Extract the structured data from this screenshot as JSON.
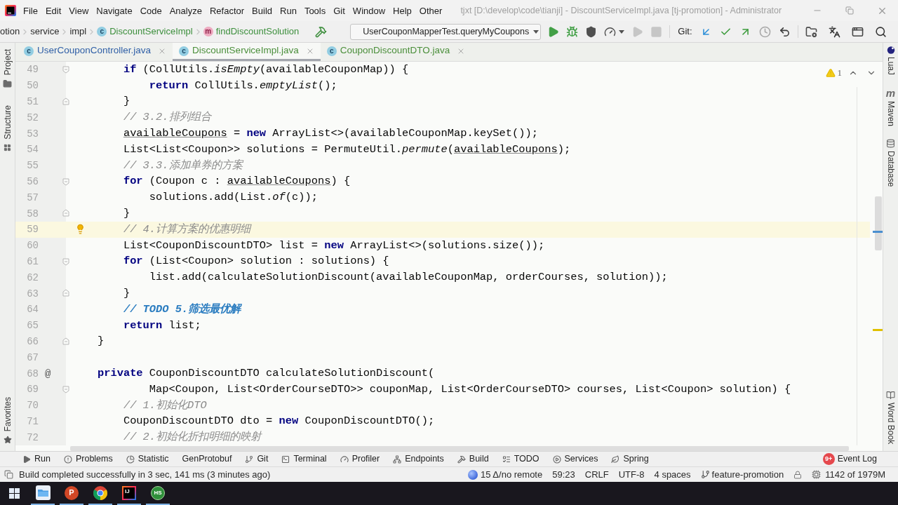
{
  "window": {
    "title": "tjxt [D:\\develop\\code\\tianji] - DiscountServiceImpl.java [tj-promotion] - Administrator"
  },
  "menu": [
    "File",
    "Edit",
    "View",
    "Navigate",
    "Code",
    "Analyze",
    "Refactor",
    "Build",
    "Run",
    "Tools",
    "Git",
    "Window",
    "Help",
    "Other"
  ],
  "breadcrumbs": [
    {
      "kind": "folder",
      "label": "otion"
    },
    {
      "kind": "folder",
      "label": "service"
    },
    {
      "kind": "folder",
      "label": "impl"
    },
    {
      "kind": "class",
      "icon": "c",
      "label": "DiscountServiceImpl"
    },
    {
      "kind": "method",
      "icon": "m",
      "label": "findDiscountSolution"
    }
  ],
  "toolbar": {
    "build": [
      {
        "kind": "build",
        "disabled": false
      }
    ],
    "run_config": {
      "label": "UserCouponMapperTest.queryMyCoupons"
    },
    "run_actions": [
      {
        "kind": "run",
        "disabled": false
      },
      {
        "kind": "debug",
        "disabled": false
      },
      {
        "kind": "coverage",
        "disabled": false
      },
      {
        "kind": "profile",
        "disabled": false
      },
      {
        "kind": "rerun",
        "disabled": true
      },
      {
        "kind": "stop",
        "disabled": true
      }
    ],
    "git": {
      "label": "Git:",
      "actions": [
        {
          "kind": "update",
          "disabled": false
        },
        {
          "kind": "commit",
          "disabled": false
        },
        {
          "kind": "push",
          "disabled": false
        },
        {
          "kind": "history",
          "disabled": false
        },
        {
          "kind": "rollback",
          "disabled": false
        }
      ]
    },
    "tools": [
      {
        "kind": "structure",
        "disabled": false
      },
      {
        "kind": "translate",
        "disabled": false
      },
      {
        "kind": "terminal",
        "disabled": false
      },
      {
        "kind": "search",
        "disabled": false
      }
    ]
  },
  "tabs": [
    {
      "icon": "c",
      "label": "UserCouponController.java",
      "color": "#2f5fa6",
      "selected": false
    },
    {
      "icon": "c",
      "label": "DiscountServiceImpl.java",
      "color": "#4b8f3b",
      "selected": true
    },
    {
      "icon": "c",
      "label": "CouponDiscountDTO.java",
      "color": "#4b8f3b",
      "selected": false
    }
  ],
  "left_tools": {
    "top": [
      {
        "kind": "project",
        "label": "Project"
      },
      {
        "kind": "structure",
        "label": "Structure"
      }
    ],
    "bottom": [
      {
        "kind": "favorites",
        "label": "Favorites"
      }
    ]
  },
  "right_tools": {
    "top": [
      {
        "kind": "luaj",
        "label": "LuaJ"
      },
      {
        "kind": "maven",
        "icon": "m",
        "label": "Maven"
      },
      {
        "kind": "database",
        "label": "Database"
      }
    ],
    "bottom": [
      {
        "kind": "wordbook",
        "label": "Word Book"
      }
    ]
  },
  "editor": {
    "problems": {
      "count": "1"
    },
    "lines": [
      {
        "number": "49",
        "current": false,
        "fold_marker": {
          "kind": "start"
        },
        "tokens": [
          {
            "kind": "keyword",
            "text": "        if"
          },
          {
            "kind": "plain",
            "text": " (CollUtils."
          },
          {
            "kind": "static",
            "text": "isEmpty"
          },
          {
            "kind": "plain",
            "text": "(availableCouponMap)) {"
          }
        ]
      },
      {
        "number": "50",
        "current": false,
        "tokens": [
          {
            "kind": "keyword",
            "text": "            return"
          },
          {
            "kind": "plain",
            "text": " CollUtils."
          },
          {
            "kind": "static",
            "text": "emptyList"
          },
          {
            "kind": "plain",
            "text": "();"
          }
        ]
      },
      {
        "number": "51",
        "current": false,
        "fold_marker": {
          "kind": "end"
        },
        "tokens": [
          {
            "kind": "plain",
            "text": "        }"
          }
        ]
      },
      {
        "number": "52",
        "current": false,
        "tokens": [
          {
            "kind": "comment",
            "text": "        // 3.2.排列组合"
          }
        ]
      },
      {
        "number": "53",
        "current": false,
        "tokens": [
          {
            "kind": "underline",
            "text": "        availableCoupons"
          },
          {
            "kind": "plain",
            "text": " = "
          },
          {
            "kind": "keyword",
            "text": "new"
          },
          {
            "kind": "plain",
            "text": " ArrayList<>(availableCouponMap.keySet());"
          }
        ]
      },
      {
        "number": "54",
        "current": false,
        "tokens": [
          {
            "kind": "plain",
            "text": "        List<List<Coupon>> solutions = PermuteUtil."
          },
          {
            "kind": "static",
            "text": "permute"
          },
          {
            "kind": "plain",
            "text": "("
          },
          {
            "kind": "underline",
            "text": "availableCoupons"
          },
          {
            "kind": "plain",
            "text": ");"
          }
        ]
      },
      {
        "number": "55",
        "current": false,
        "tokens": [
          {
            "kind": "comment",
            "text": "        // 3.3.添加单券的方案"
          }
        ]
      },
      {
        "number": "56",
        "current": false,
        "fold_marker": {
          "kind": "start"
        },
        "tokens": [
          {
            "kind": "keyword",
            "text": "        for"
          },
          {
            "kind": "plain",
            "text": " (Coupon c : "
          },
          {
            "kind": "underline",
            "text": "availableCoupons"
          },
          {
            "kind": "plain",
            "text": ") {"
          }
        ]
      },
      {
        "number": "57",
        "current": false,
        "tokens": [
          {
            "kind": "plain",
            "text": "            solutions.add(List."
          },
          {
            "kind": "static",
            "text": "of"
          },
          {
            "kind": "plain",
            "text": "(c));"
          }
        ]
      },
      {
        "number": "58",
        "current": false,
        "fold_marker": {
          "kind": "end"
        },
        "tokens": [
          {
            "kind": "plain",
            "text": "        }"
          }
        ]
      },
      {
        "number": "59",
        "current": true,
        "gutter_icon": {
          "kind": "bulb"
        },
        "tokens": [
          {
            "kind": "comment",
            "text": "        // 4.计算方案的优惠明细"
          }
        ]
      },
      {
        "number": "60",
        "current": false,
        "tokens": [
          {
            "kind": "plain",
            "text": "        List<CouponDiscountDTO> list = "
          },
          {
            "kind": "keyword",
            "text": "new"
          },
          {
            "kind": "plain",
            "text": " ArrayList<>(solutions.size());"
          }
        ]
      },
      {
        "number": "61",
        "current": false,
        "fold_marker": {
          "kind": "start"
        },
        "tokens": [
          {
            "kind": "keyword",
            "text": "        for"
          },
          {
            "kind": "plain",
            "text": " (List<Coupon> solution : solutions) {"
          }
        ]
      },
      {
        "number": "62",
        "current": false,
        "tokens": [
          {
            "kind": "plain",
            "text": "            list.add(calculateSolutionDiscount(availableCouponMap, orderCourses, solution));"
          }
        ]
      },
      {
        "number": "63",
        "current": false,
        "fold_marker": {
          "kind": "end"
        },
        "tokens": [
          {
            "kind": "plain",
            "text": "        }"
          }
        ]
      },
      {
        "number": "64",
        "current": false,
        "tokens": [
          {
            "kind": "todo",
            "text": "        // TODO 5.筛选最优解"
          }
        ]
      },
      {
        "number": "65",
        "current": false,
        "tokens": [
          {
            "kind": "keyword",
            "text": "        return"
          },
          {
            "kind": "plain",
            "text": " list;"
          }
        ]
      },
      {
        "number": "66",
        "current": false,
        "fold_marker": {
          "kind": "end"
        },
        "tokens": [
          {
            "kind": "plain",
            "text": "    }"
          }
        ]
      },
      {
        "number": "67",
        "current": false
      },
      {
        "number": "68",
        "current": false,
        "gutter_text": "@",
        "tokens": [
          {
            "kind": "keyword",
            "text": "    private"
          },
          {
            "kind": "plain",
            "text": " CouponDiscountDTO calculateSolutionDiscount("
          }
        ]
      },
      {
        "number": "69",
        "current": false,
        "fold_marker": {
          "kind": "start"
        },
        "tokens": [
          {
            "kind": "plain",
            "text": "            Map<Coupon, List<OrderCourseDTO>> couponMap, List<OrderCourseDTO> courses, List<Coupon> solution) {"
          }
        ]
      },
      {
        "number": "70",
        "current": false,
        "tokens": [
          {
            "kind": "comment",
            "text": "        // 1.初始化DTO"
          }
        ]
      },
      {
        "number": "71",
        "current": false,
        "tokens": [
          {
            "kind": "plain",
            "text": "        CouponDiscountDTO dto = "
          },
          {
            "kind": "keyword",
            "text": "new"
          },
          {
            "kind": "plain",
            "text": " CouponDiscountDTO();"
          }
        ]
      },
      {
        "number": "72",
        "current": false,
        "tokens": [
          {
            "kind": "comment",
            "text": "        // 2.初始化折扣明细的映射"
          }
        ]
      }
    ]
  },
  "bottom_tools": {
    "left": [
      {
        "kind": "run",
        "label": "Run"
      },
      {
        "kind": "problems",
        "label": "Problems"
      },
      {
        "kind": "statistic",
        "label": "Statistic"
      },
      {
        "kind": "plain",
        "label": "GenProtobuf"
      },
      {
        "kind": "git",
        "label": "Git"
      },
      {
        "kind": "terminal",
        "label": "Terminal"
      },
      {
        "kind": "profiler",
        "label": "Profiler"
      },
      {
        "kind": "endpoints",
        "label": "Endpoints"
      },
      {
        "kind": "build",
        "label": "Build"
      },
      {
        "kind": "todo",
        "label": "TODO"
      },
      {
        "kind": "services",
        "label": "Services"
      },
      {
        "kind": "spring",
        "label": "Spring"
      }
    ],
    "right": [
      {
        "kind": "event_log",
        "label": "Event Log",
        "badge": "9+"
      }
    ]
  },
  "status_bar": {
    "message": "Build completed successfully in 3 sec, 141 ms (3 minutes ago)",
    "items": [
      {
        "kind": "vcs",
        "text": "15 Δ/no remote"
      },
      {
        "kind": "plain",
        "text": "59:23"
      },
      {
        "kind": "plain",
        "text": "CRLF"
      },
      {
        "kind": "plain",
        "text": "UTF-8"
      },
      {
        "kind": "plain",
        "text": "4 spaces"
      },
      {
        "kind": "branch",
        "text": "feature-promotion"
      },
      {
        "kind": "lock"
      },
      {
        "kind": "memory",
        "text": "1142 of 1979M"
      }
    ]
  },
  "taskbar": {
    "apps": [
      {
        "kind": "explorer",
        "running": true
      },
      {
        "kind": "powerpoint",
        "glyph": "P",
        "running": true
      },
      {
        "kind": "chrome",
        "running": true
      },
      {
        "kind": "intellij",
        "glyph": "IJ",
        "running": true
      },
      {
        "kind": "hs",
        "glyph": "HS",
        "running": true
      }
    ]
  }
}
